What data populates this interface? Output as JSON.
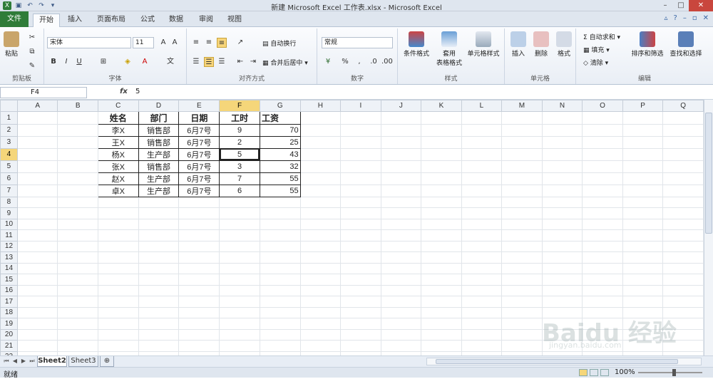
{
  "window": {
    "title": "新建 Microsoft Excel 工作表.xlsx - Microsoft Excel"
  },
  "tabs": {
    "file": "文件",
    "items": [
      "开始",
      "插入",
      "页面布局",
      "公式",
      "数据",
      "审阅",
      "视图"
    ],
    "active": 0
  },
  "ribbon": {
    "clipboard": {
      "label": "剪贴板",
      "paste": "粘贴"
    },
    "font": {
      "label": "字体",
      "name": "宋体",
      "size": "11",
      "bold": "B",
      "italic": "I",
      "underline": "U"
    },
    "alignment": {
      "label": "对齐方式",
      "wrap": "自动换行",
      "merge": "合并后居中"
    },
    "number": {
      "label": "数字",
      "format": "常规",
      "percent": "%",
      "comma": ","
    },
    "styles": {
      "label": "样式",
      "conditional": "条件格式",
      "table_line1": "套用",
      "table_line2": "表格格式",
      "cell_styles": "单元格样式"
    },
    "cells": {
      "label": "单元格",
      "insert": "插入",
      "delete": "删除",
      "format": "格式"
    },
    "editing": {
      "label": "编辑",
      "autosum": "自动求和",
      "fill": "填充",
      "clear": "清除",
      "sort": "排序和筛选",
      "find": "查找和选择"
    }
  },
  "formula_bar": {
    "name_box": "F4",
    "fx": "fx",
    "value": "5"
  },
  "columns": [
    "A",
    "B",
    "C",
    "D",
    "E",
    "F",
    "G",
    "H",
    "I",
    "J",
    "K",
    "L",
    "M",
    "N",
    "O",
    "P",
    "Q"
  ],
  "selected_column": "F",
  "selected_row": 4,
  "row_count": 23,
  "table": {
    "headers": [
      "姓名",
      "部门",
      "日期",
      "工时",
      "工资"
    ],
    "rows": [
      [
        "李X",
        "销售部",
        "6月7号",
        "9",
        "70"
      ],
      [
        "王X",
        "销售部",
        "6月7号",
        "2",
        "25"
      ],
      [
        "杨X",
        "生产部",
        "6月7号",
        "5",
        "43"
      ],
      [
        "张X",
        "销售部",
        "6月7号",
        "3",
        "32"
      ],
      [
        "赵X",
        "生产部",
        "6月7号",
        "7",
        "55"
      ],
      [
        "卓X",
        "生产部",
        "6月7号",
        "6",
        "55"
      ]
    ]
  },
  "sheets": [
    "Sheet2",
    "Sheet3"
  ],
  "active_sheet": 0,
  "status": {
    "ready": "就绪",
    "zoom": "100%"
  },
  "watermark": {
    "logo": "Baidu 经验",
    "url": "jingyan.baidu.com"
  }
}
